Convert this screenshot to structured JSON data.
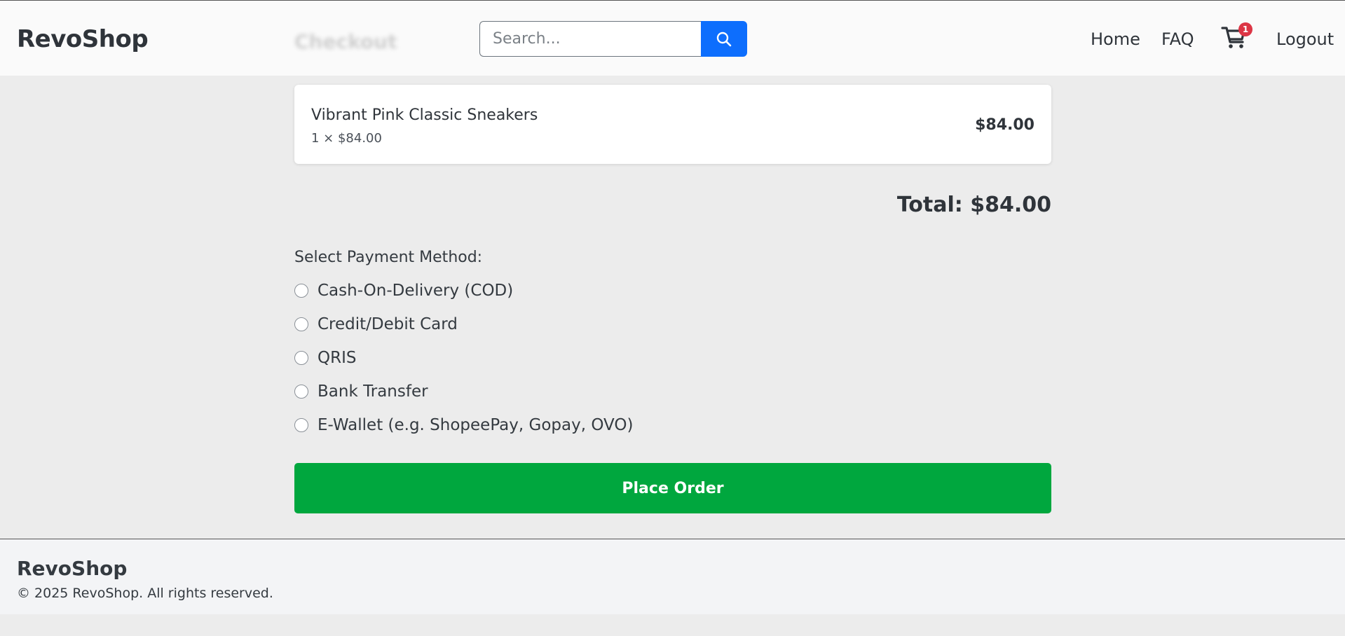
{
  "header": {
    "logo": "RevoShop",
    "ghost_title": "Checkout",
    "search_placeholder": "Search...",
    "nav": {
      "home": "Home",
      "faq": "FAQ",
      "logout": "Logout"
    },
    "cart_count": "1"
  },
  "order": {
    "item": {
      "name": "Vibrant Pink Classic Sneakers",
      "qty_line": "1 × $84.00",
      "price": "$84.00"
    },
    "total": "Total: $84.00"
  },
  "payment": {
    "label": "Select Payment Method:",
    "options": [
      "Cash-On-Delivery (COD)",
      "Credit/Debit Card",
      "QRIS",
      "Bank Transfer",
      "E-Wallet (e.g. ShopeePay, Gopay, OVO)"
    ]
  },
  "actions": {
    "place_order": "Place Order"
  },
  "footer": {
    "brand": "RevoShop",
    "copyright": "© 2025 RevoShop. All rights reserved."
  },
  "colors": {
    "primary": "#0d6efd",
    "success": "#00a73e",
    "badge": "#dc3545"
  }
}
